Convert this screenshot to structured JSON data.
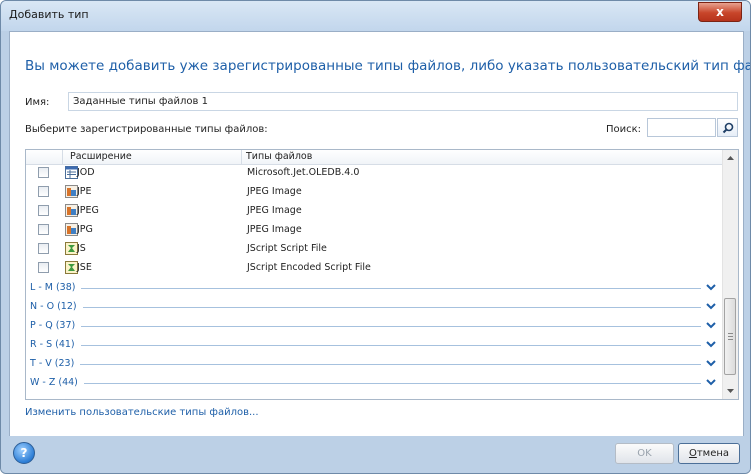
{
  "window": {
    "title": "Добавить тип",
    "close_glyph": "x",
    "headline": "Вы можете добавить уже зарегистрированные типы файлов, либо указать пользовательский тип файлов."
  },
  "name_field": {
    "label": "Имя:",
    "value": "Заданные типы файлов 1"
  },
  "select_label": "Выберите зарегистрированные типы файлов:",
  "search": {
    "label": "Поиск:",
    "value": "",
    "icon": "search-icon"
  },
  "table": {
    "headers": {
      "extension": "Расширение",
      "file_type": "Типы файлов"
    },
    "rows": [
      {
        "ext": "JOD",
        "type": "Microsoft.Jet.OLEDB.4.0",
        "icon": "database-icon",
        "checked": false
      },
      {
        "ext": "JPE",
        "type": "JPEG Image",
        "icon": "image-icon",
        "checked": false
      },
      {
        "ext": "JPEG",
        "type": "JPEG Image",
        "icon": "image-icon",
        "checked": false
      },
      {
        "ext": "JPG",
        "type": "JPEG Image",
        "icon": "image-icon",
        "checked": false
      },
      {
        "ext": "JS",
        "type": "JScript Script File",
        "icon": "script-icon",
        "checked": false
      },
      {
        "ext": "JSE",
        "type": "JScript Encoded Script File",
        "icon": "script-icon",
        "checked": false
      }
    ],
    "groups": [
      {
        "label": "L - M (38)"
      },
      {
        "label": "N - O (12)"
      },
      {
        "label": "P - Q (37)"
      },
      {
        "label": "R - S (41)"
      },
      {
        "label": "T - V (23)"
      },
      {
        "label": "W - Z (44)"
      }
    ]
  },
  "edit_link": "Изменить пользовательские типы файлов...",
  "footer": {
    "help_glyph": "?",
    "ok_label": "OK",
    "cancel_first": "О",
    "cancel_rest": "тмена"
  },
  "colors": {
    "accent": "#1e5fa8",
    "frame": "#bcd0e6",
    "close": "#c8452a"
  }
}
